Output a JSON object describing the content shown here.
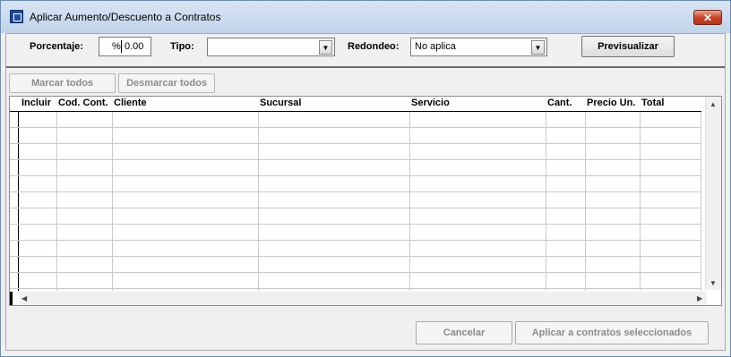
{
  "window": {
    "title": "Aplicar Aumento/Descuento a Contratos"
  },
  "filters": {
    "percentage_label": "Porcentaje:",
    "percentage_prefix": "%",
    "percentage_value": "0.00",
    "type_label": "Tipo:",
    "type_value": "",
    "rounding_label": "Redondeo:",
    "rounding_value": "No aplica",
    "preview_button": "Previsualizar"
  },
  "selection": {
    "mark_all": "Marcar todos",
    "unmark_all": "Desmarcar todos"
  },
  "grid": {
    "columns": [
      "Incluir",
      "Cod. Cont.",
      "Cliente",
      "Sucursal",
      "Servicio",
      "Cant.",
      "Precio Un.",
      "Total"
    ],
    "rows": []
  },
  "footer": {
    "cancel": "Cancelar",
    "apply": "Aplicar a contratos seleccionados"
  },
  "icons": {
    "app": "app-window-icon",
    "close": "close-x-icon",
    "combo": "chevron-down-icon"
  }
}
